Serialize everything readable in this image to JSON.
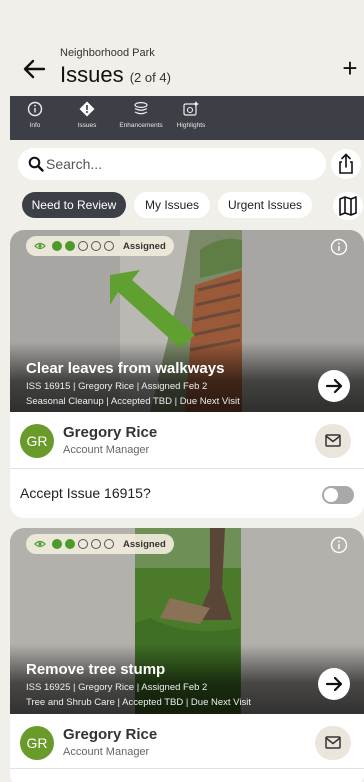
{
  "header": {
    "subtitle": "Neighborhood Park",
    "title": "Issues",
    "count": "(2 of 4)"
  },
  "tabs": [
    {
      "label": "Info",
      "icon": "info-icon"
    },
    {
      "label": "Issues",
      "icon": "alert-icon",
      "active": true
    },
    {
      "label": "Enhancements",
      "icon": "layers-icon"
    },
    {
      "label": "Highlights",
      "icon": "photo-star-icon"
    }
  ],
  "search": {
    "placeholder": "Search..."
  },
  "filters": [
    {
      "label": "Need to Review",
      "active": true
    },
    {
      "label": "My Issues",
      "active": false
    },
    {
      "label": "Urgent Issues",
      "active": false
    }
  ],
  "issues": [
    {
      "title": "Clear leaves from walkways",
      "meta1": "ISS 16915 | Gregory Rice | Assigned Feb 2",
      "meta2": "Seasonal Cleanup | Accepted TBD | Due Next Visit",
      "status": "Assigned",
      "progress": 2,
      "steps": 5,
      "assignee": {
        "initials": "GR",
        "name": "Gregory Rice",
        "role": "Account Manager"
      },
      "accept_label": "Accept Issue 16915?",
      "accepted": false
    },
    {
      "title": "Remove tree stump",
      "meta1": "ISS 16925 | Gregory Rice | Assigned Feb 2",
      "meta2": "Tree and Shrub Care | Accepted TBD | Due Next Visit",
      "status": "Assigned",
      "progress": 2,
      "steps": 5,
      "assignee": {
        "initials": "GR",
        "name": "Gregory Rice",
        "role": "Account Manager"
      }
    }
  ],
  "colors": {
    "accent": "#4c9a2a",
    "tabbar": "#3d3f47",
    "background": "#f0efea"
  }
}
